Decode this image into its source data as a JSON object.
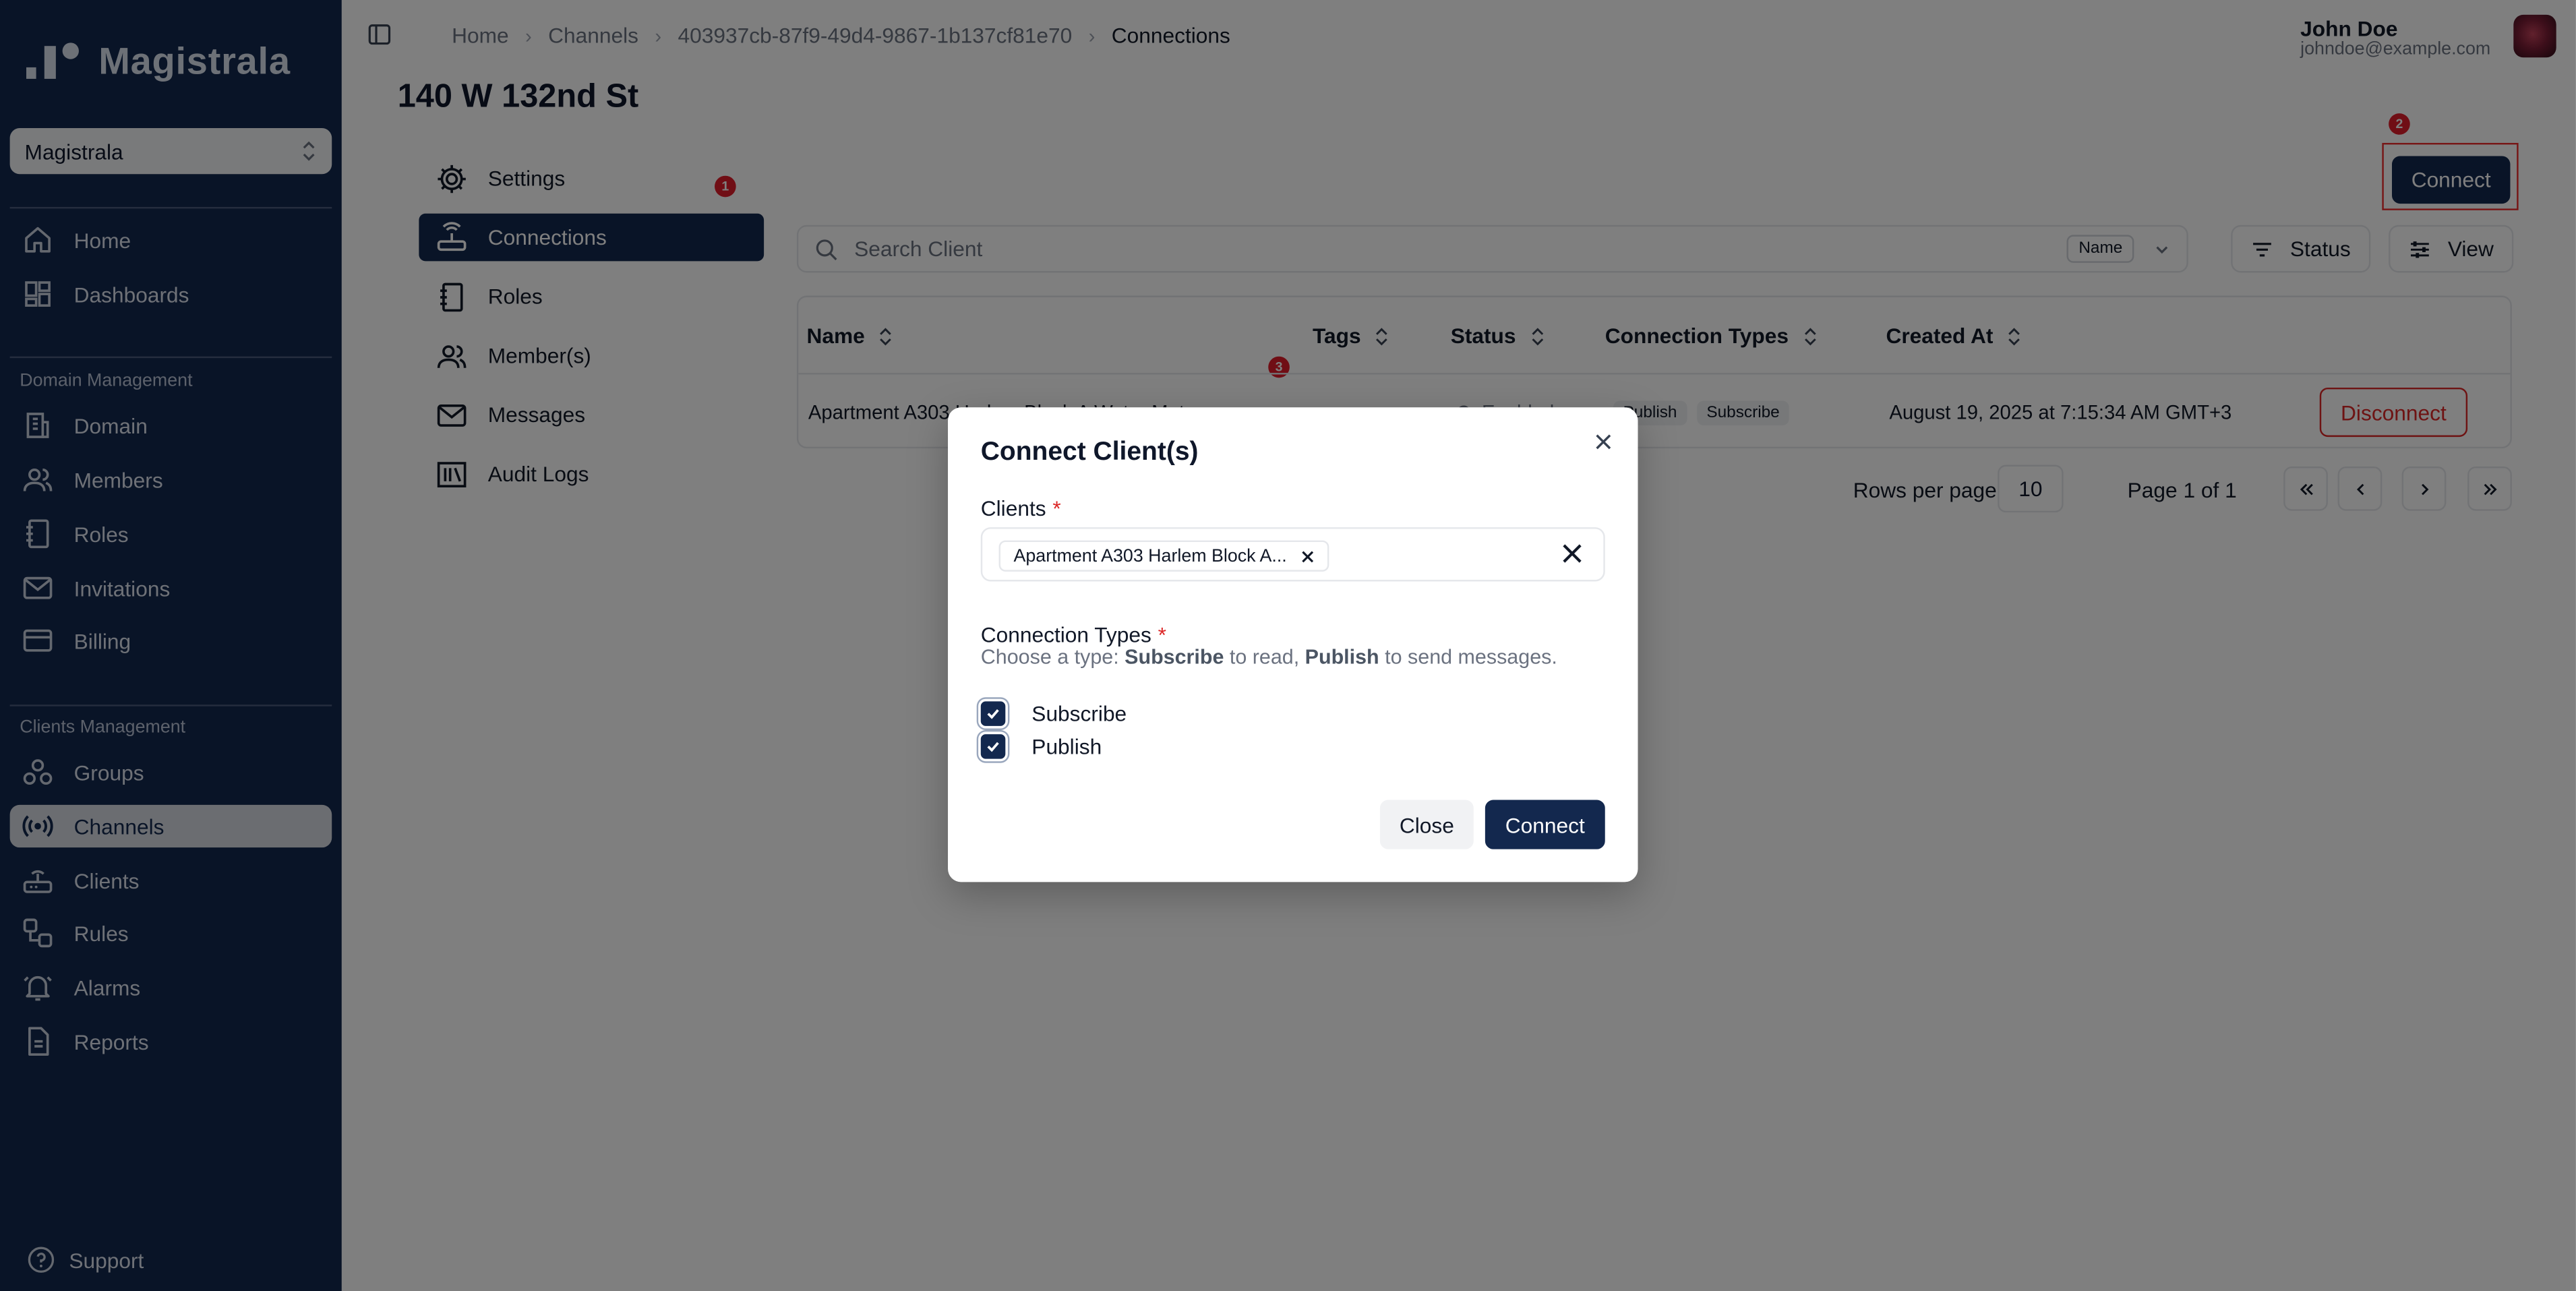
{
  "app": {
    "name": "Magistrala"
  },
  "sidebar": {
    "domain_selector": "Magistrala",
    "items_top": [
      {
        "label": "Home",
        "icon": "home-icon"
      },
      {
        "label": "Dashboards",
        "icon": "dashboard-icon"
      }
    ],
    "domain_section_label": "Domain Management",
    "items_domain": [
      {
        "label": "Domain",
        "icon": "building-icon"
      },
      {
        "label": "Members",
        "icon": "users-icon"
      },
      {
        "label": "Roles",
        "icon": "roles-icon"
      },
      {
        "label": "Invitations",
        "icon": "mail-icon"
      },
      {
        "label": "Billing",
        "icon": "credit-card-icon"
      }
    ],
    "clients_section_label": "Clients Management",
    "items_clients": [
      {
        "label": "Groups",
        "icon": "groups-icon"
      },
      {
        "label": "Channels",
        "icon": "radio-icon",
        "active": true
      },
      {
        "label": "Clients",
        "icon": "router-icon"
      },
      {
        "label": "Rules",
        "icon": "workflow-icon"
      },
      {
        "label": "Alarms",
        "icon": "bell-icon"
      },
      {
        "label": "Reports",
        "icon": "file-icon"
      }
    ],
    "support": "Support"
  },
  "breadcrumb": {
    "items": [
      "Home",
      "Channels",
      "403937cb-87f9-49d4-9867-1b137cf81e70",
      "Connections"
    ]
  },
  "user": {
    "name": "John Doe",
    "email": "johndoe@example.com"
  },
  "page": {
    "title": "140 W 132nd St"
  },
  "side_menu": [
    {
      "label": "Settings",
      "icon": "gear-icon"
    },
    {
      "label": "Connections",
      "icon": "connections-icon",
      "active": true
    },
    {
      "label": "Roles",
      "icon": "notebook-icon"
    },
    {
      "label": "Member(s)",
      "icon": "users-icon"
    },
    {
      "label": "Messages",
      "icon": "inbox-icon"
    },
    {
      "label": "Audit Logs",
      "icon": "library-icon"
    }
  ],
  "badges": {
    "b1": "1",
    "b2": "2",
    "b3": "3"
  },
  "toolbar": {
    "connect_label": "Connect",
    "search_placeholder": "Search Client",
    "search_field": "Name",
    "status_label": "Status",
    "view_label": "View"
  },
  "table": {
    "columns": [
      "Name",
      "Tags",
      "Status",
      "Connection Types",
      "Created At"
    ],
    "rows": [
      {
        "name": "Apartment A303 Harlem Block A Water Meter",
        "status": "Enabled",
        "types": [
          "Publish",
          "Subscribe"
        ],
        "created": "August 19, 2025 at 7:15:34 AM GMT+3",
        "action": "Disconnect"
      }
    ]
  },
  "pagination": {
    "rows_label": "Rows per page",
    "rows_value": "10",
    "page_label": "Page 1 of 1"
  },
  "modal": {
    "title": "Connect Client(s)",
    "clients_label": "Clients",
    "required_mark": "*",
    "selected_client": "Apartment A303 Harlem Block A...",
    "types_label": "Connection Types",
    "hint_prefix": "Choose a type: ",
    "hint_sub": "Subscribe",
    "hint_mid": " to read, ",
    "hint_pub": "Publish",
    "hint_suffix": " to send messages.",
    "options": [
      {
        "label": "Subscribe",
        "checked": true
      },
      {
        "label": "Publish",
        "checked": true
      }
    ],
    "close_label": "Close",
    "connect_label": "Connect"
  },
  "colors": {
    "primary": "#13284e",
    "danger": "#dc2626",
    "badge": "#e11d2a"
  }
}
